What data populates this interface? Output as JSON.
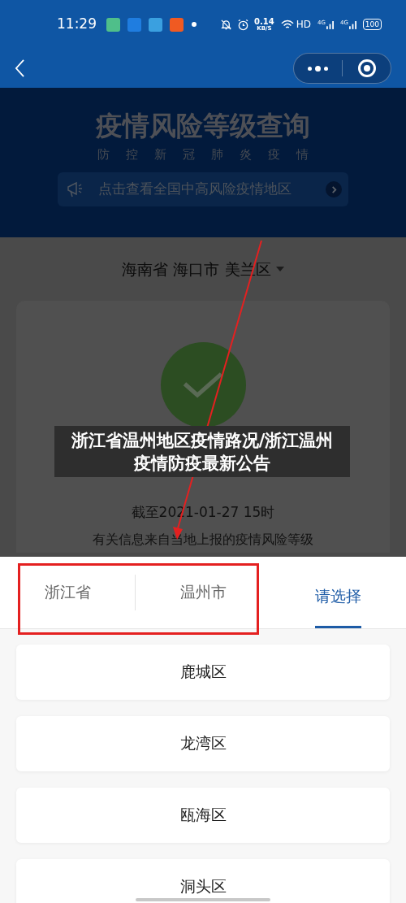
{
  "status_bar": {
    "time": "11:29",
    "network_speed": "0.14",
    "speed_unit": "KB/S",
    "hd": "HD",
    "signals": [
      "4G",
      "4G"
    ],
    "battery": "100"
  },
  "header": {
    "title": "疫情风险等级查询",
    "subtitle": "防控新冠肺炎疫情",
    "notice": "点击查看全国中高风险疫情地区"
  },
  "location_selector": {
    "value": "海南省 海口市 美兰区"
  },
  "result_card": {
    "updated": "截至2021-01-27 15时",
    "note": "有关信息来自当地上报的疫情风险等级"
  },
  "caption_overlay": "浙江省温州地区疫情路况/浙江温州疫情防疫最新公告",
  "region_picker": {
    "tabs": [
      {
        "label": "浙江省",
        "selected": false
      },
      {
        "label": "温州市",
        "selected": false
      },
      {
        "label": "请选择",
        "selected": true
      }
    ],
    "options": [
      "鹿城区",
      "龙湾区",
      "瓯海区",
      "洞头区"
    ]
  }
}
